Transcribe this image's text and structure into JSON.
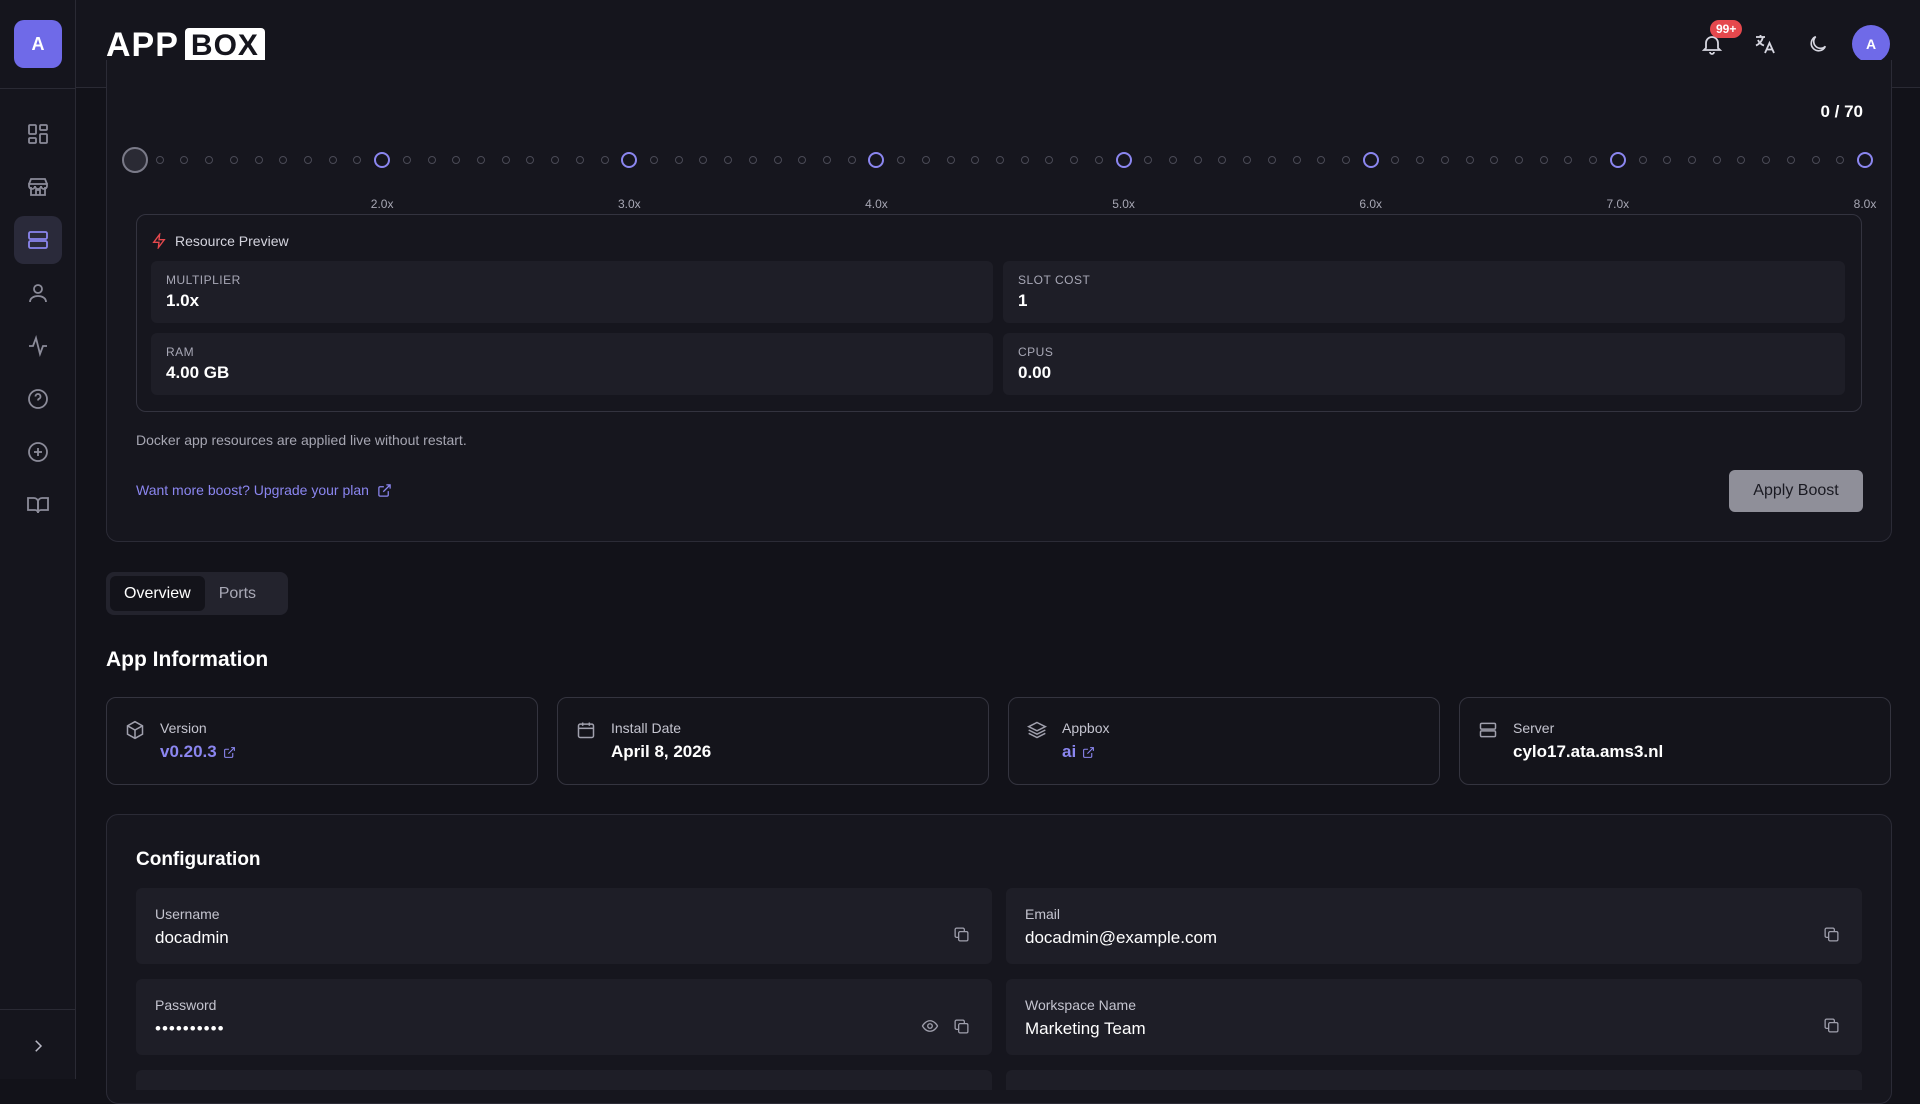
{
  "app": {
    "logo_app": "APP",
    "logo_box": "BOX",
    "user_initial": "A"
  },
  "sidebar": {
    "items": [
      {
        "name": "dashboard",
        "icon": "dashboard-icon",
        "active": false
      },
      {
        "name": "store",
        "icon": "store-icon",
        "active": false
      },
      {
        "name": "servers",
        "icon": "server-icon",
        "active": true
      },
      {
        "name": "account",
        "icon": "user-icon",
        "active": false
      },
      {
        "name": "activity",
        "icon": "activity-icon",
        "active": false
      },
      {
        "name": "help",
        "icon": "help-circle-icon",
        "active": false
      },
      {
        "name": "add",
        "icon": "plus-circle-icon",
        "active": false
      },
      {
        "name": "docs",
        "icon": "book-icon",
        "active": false
      }
    ],
    "expand_icon": "chevron-right-icon"
  },
  "header": {
    "notifications_badge": "99+",
    "avatar_initial": "A"
  },
  "boost": {
    "slot_count": "0 / 70",
    "slider": {
      "min": 1.0,
      "max": 8.0,
      "value": 1.0,
      "step": 0.1,
      "tick_labels": [
        "2.0x",
        "3.0x",
        "4.0x",
        "5.0x",
        "6.0x",
        "7.0x",
        "8.0x"
      ]
    },
    "preview": {
      "title": "Resource Preview",
      "multiplier_label": "MULTIPLIER",
      "multiplier_value": "1.0x",
      "slot_cost_label": "SLOT COST",
      "slot_cost_value": "1",
      "ram_label": "RAM",
      "ram_value": "4.00 GB",
      "cpus_label": "CPUS",
      "cpus_value": "0.00"
    },
    "live_note": "Docker app resources are applied live without restart.",
    "upgrade_link": "Want more boost? Upgrade your plan",
    "apply_label": "Apply Boost"
  },
  "tabs": {
    "overview": "Overview",
    "ports": "Ports",
    "active": "overview"
  },
  "app_info": {
    "title": "App Information",
    "version_label": "Version",
    "version_value": "v0.20.3",
    "install_label": "Install Date",
    "install_value": "April 8, 2026",
    "appbox_label": "Appbox",
    "appbox_value": "ai",
    "server_label": "Server",
    "server_value": "cylo17.ata.ams3.nl"
  },
  "configuration": {
    "title": "Configuration",
    "username_label": "Username",
    "username_value": "docadmin",
    "email_label": "Email",
    "email_value": "docadmin@example.com",
    "password_label": "Password",
    "password_value": "••••••••••",
    "workspace_label": "Workspace Name",
    "workspace_value": "Marketing Team"
  },
  "colors": {
    "accent": "#8b86f0",
    "avatar": "#6f6ae8",
    "badge": "#e5484d",
    "background": "#121219"
  }
}
